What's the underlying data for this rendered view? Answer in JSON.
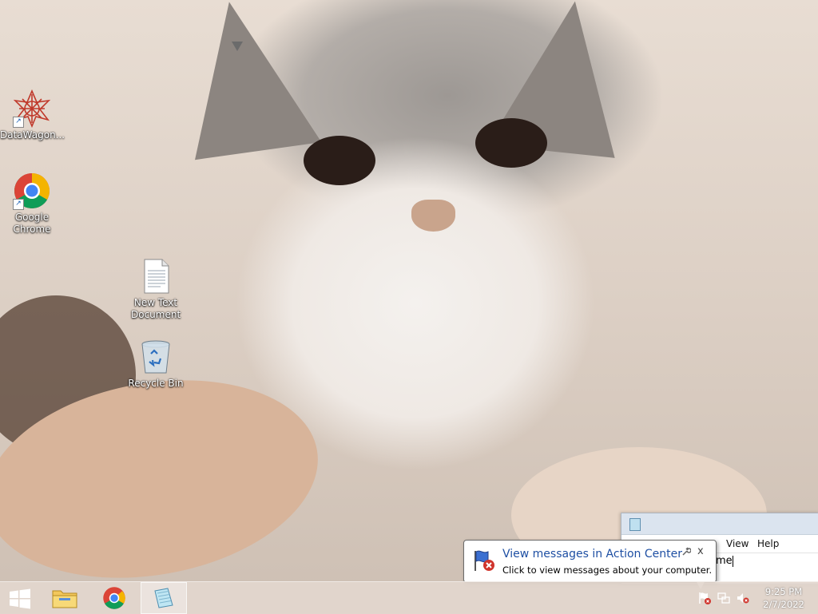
{
  "desktop": {
    "icons": [
      {
        "label": "DataWagon..."
      },
      {
        "label": "Google Chrome"
      },
      {
        "label": "New Text Document"
      },
      {
        "label": "Recycle Bin"
      }
    ]
  },
  "notepad": {
    "menu": [
      "View",
      "Help"
    ],
    "visible_text": "ome"
  },
  "notification": {
    "title": "View messages in Action Center",
    "body": "Click to view messages about your computer.",
    "options_icon": "wrench-icon",
    "close_label": "x"
  },
  "taskbar": {
    "pinned": [
      {
        "icon": "file-explorer-icon"
      },
      {
        "icon": "chrome-icon"
      },
      {
        "icon": "notepad-icon",
        "active": true
      }
    ],
    "tray": [
      "action-center-flag-icon",
      "network-icon",
      "volume-muted-icon"
    ],
    "clock": {
      "time": "9:25 PM",
      "date": "2/7/2022"
    }
  }
}
